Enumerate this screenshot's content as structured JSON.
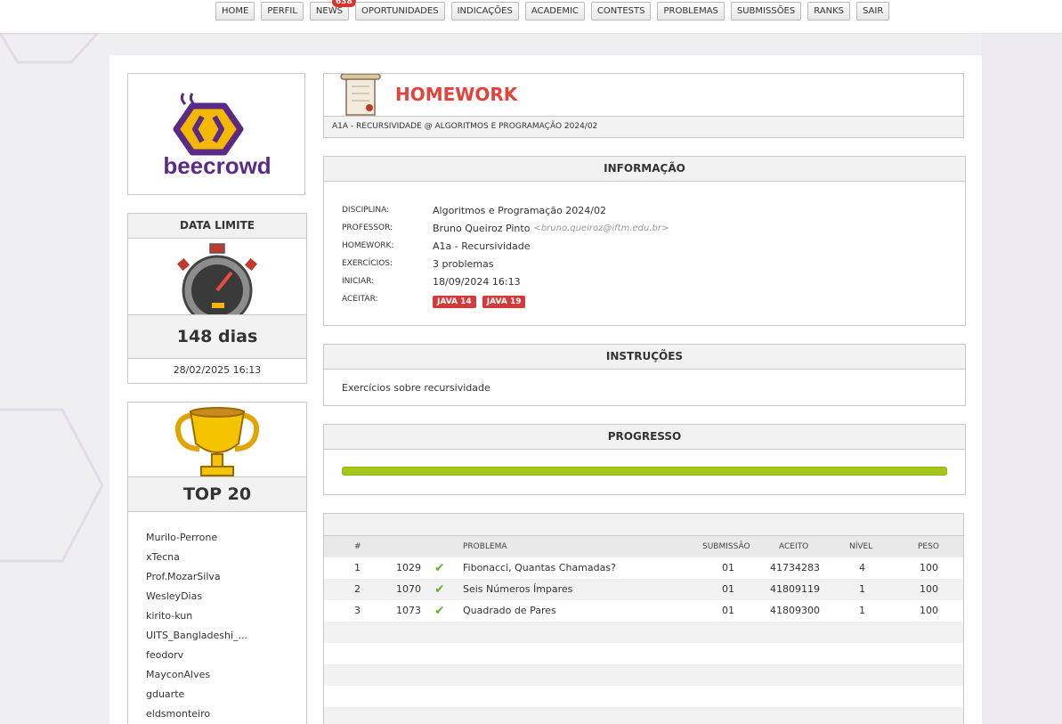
{
  "nav": [
    {
      "label": "HOME"
    },
    {
      "label": "PERFIL"
    },
    {
      "label": "NEWS",
      "badge": "638"
    },
    {
      "label": "OPORTUNIDADES"
    },
    {
      "label": "INDICAÇÕES"
    },
    {
      "label": "ACADEMIC"
    },
    {
      "label": "CONTESTS"
    },
    {
      "label": "PROBLEMAS"
    },
    {
      "label": "SUBMISSÕES"
    },
    {
      "label": "RANKS"
    },
    {
      "label": "SAIR"
    }
  ],
  "logo": {
    "text": "beecrowd",
    "color": "#5b2a86"
  },
  "deadline": {
    "title": "DATA LIMITE",
    "days": "148 dias",
    "date": "28/02/2025 16:13"
  },
  "top": {
    "title": "TOP 20",
    "users": [
      "Murilo-Perrone",
      "xTecna",
      "Prof.MozarSilva",
      "WesleyDias",
      "kirito-kun",
      "UITS_Bangladeshi_...",
      "feodorv",
      "MayconAlves",
      "gduarte",
      "eldsmonteiro"
    ]
  },
  "homework": {
    "title": "HOMEWORK",
    "subtitle": "A1A - RECURSIVIDADE @ ALGORITMOS E PROGRAMAÇÃO 2024/02",
    "title_color": "#e0443a"
  },
  "info": {
    "title": "INFORMAÇÃO",
    "rows": [
      {
        "label": "DISCIPLINA:",
        "value": "Algoritmos e Programação 2024/02"
      },
      {
        "label": "PROFESSOR:",
        "value": "Bruno Queiroz Pinto",
        "email": "<bruno.queiroz@iftm.edu.br>"
      },
      {
        "label": "HOMEWORK:",
        "value": "A1a - Recursividade"
      },
      {
        "label": "EXERCÍCIOS:",
        "value": "3 problemas"
      },
      {
        "label": "INICIAR:",
        "value": "18/09/2024 16:13"
      },
      {
        "label": "ACEITAR:"
      }
    ],
    "languages": [
      "JAVA 14",
      "JAVA 19"
    ]
  },
  "instructions": {
    "title": "INSTRUÇÕES",
    "text": "Exercícios sobre recursividade"
  },
  "progress": {
    "title": "PROGRESSO",
    "fraction": 1.0,
    "color": "#a5c61a"
  },
  "table": {
    "headers": [
      "#",
      "PROBLEMA",
      "SUBMISSÃO",
      "ACEITO",
      "NÍVEL",
      "PESO"
    ],
    "rows": [
      {
        "num": "1",
        "id": "1029",
        "problem": "Fibonacci, Quantas Chamadas?",
        "submission": "01",
        "accepted": "41734283",
        "level": "4",
        "weight": "100"
      },
      {
        "num": "2",
        "id": "1070",
        "problem": "Seis Números Ímpares",
        "submission": "01",
        "accepted": "41809119",
        "level": "1",
        "weight": "100"
      },
      {
        "num": "3",
        "id": "1073",
        "problem": "Quadrado de Pares",
        "submission": "01",
        "accepted": "41809300",
        "level": "1",
        "weight": "100"
      }
    ]
  }
}
